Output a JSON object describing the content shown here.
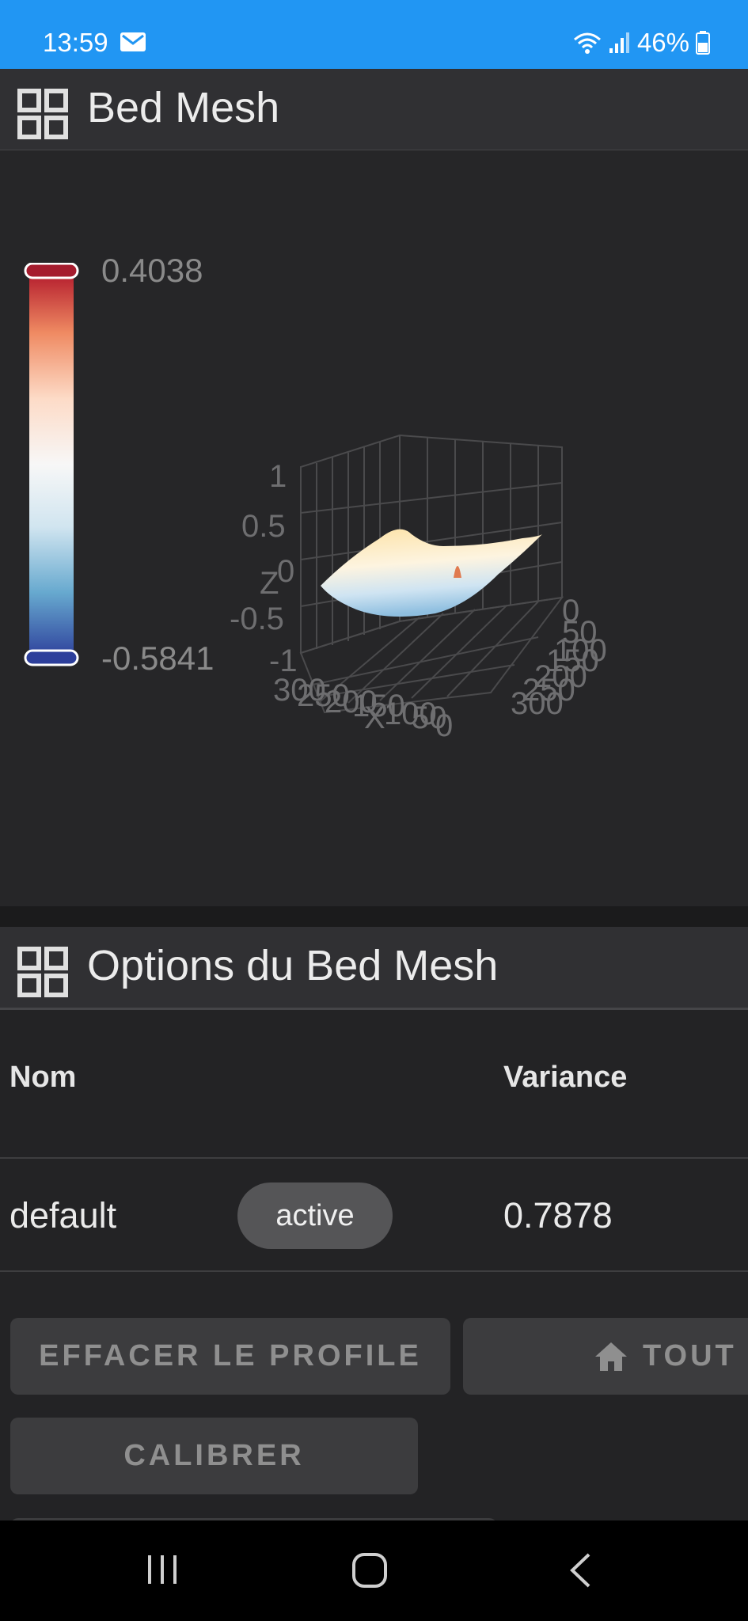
{
  "status_bar": {
    "time": "13:59",
    "battery": "46%",
    "icons": [
      "mail-icon",
      "wifi-icon",
      "signal-icon",
      "battery-icon"
    ]
  },
  "mesh_card": {
    "title": "Bed Mesh",
    "header_icon": "grid-icon",
    "scale": {
      "max": "0.4038",
      "min": "-0.5841",
      "colors": [
        "#b2182b",
        "#ef8a62",
        "#fddbc7",
        "#f7f7f7",
        "#d1e5f0",
        "#67a9cf",
        "#2d3f9b"
      ]
    },
    "plot": {
      "z_axis_label": "Z",
      "z_ticks": [
        "1",
        "0.5",
        "0",
        "-0.5",
        "-1"
      ],
      "x_axis_label": "X",
      "x_ticks": [
        "300",
        "250",
        "200",
        "150",
        "100",
        "50",
        "0"
      ],
      "y_ticks": [
        "0",
        "50",
        "100",
        "150",
        "200",
        "250",
        "300"
      ]
    }
  },
  "options_card": {
    "title": "Options du Bed Mesh",
    "header_icon": "grid-icon",
    "table": {
      "headers": {
        "name": "Nom",
        "variance": "Variance"
      },
      "rows": [
        {
          "name": "default",
          "status": "active",
          "variance": "0.7878"
        }
      ]
    },
    "buttons": {
      "clear_profile": "EFFACER LE PROFILE",
      "home_all": "TOUT",
      "calibrate": "CALIBRER"
    }
  },
  "nav_bar": {
    "icons": [
      "recents-icon",
      "home-icon",
      "back-icon"
    ]
  }
}
